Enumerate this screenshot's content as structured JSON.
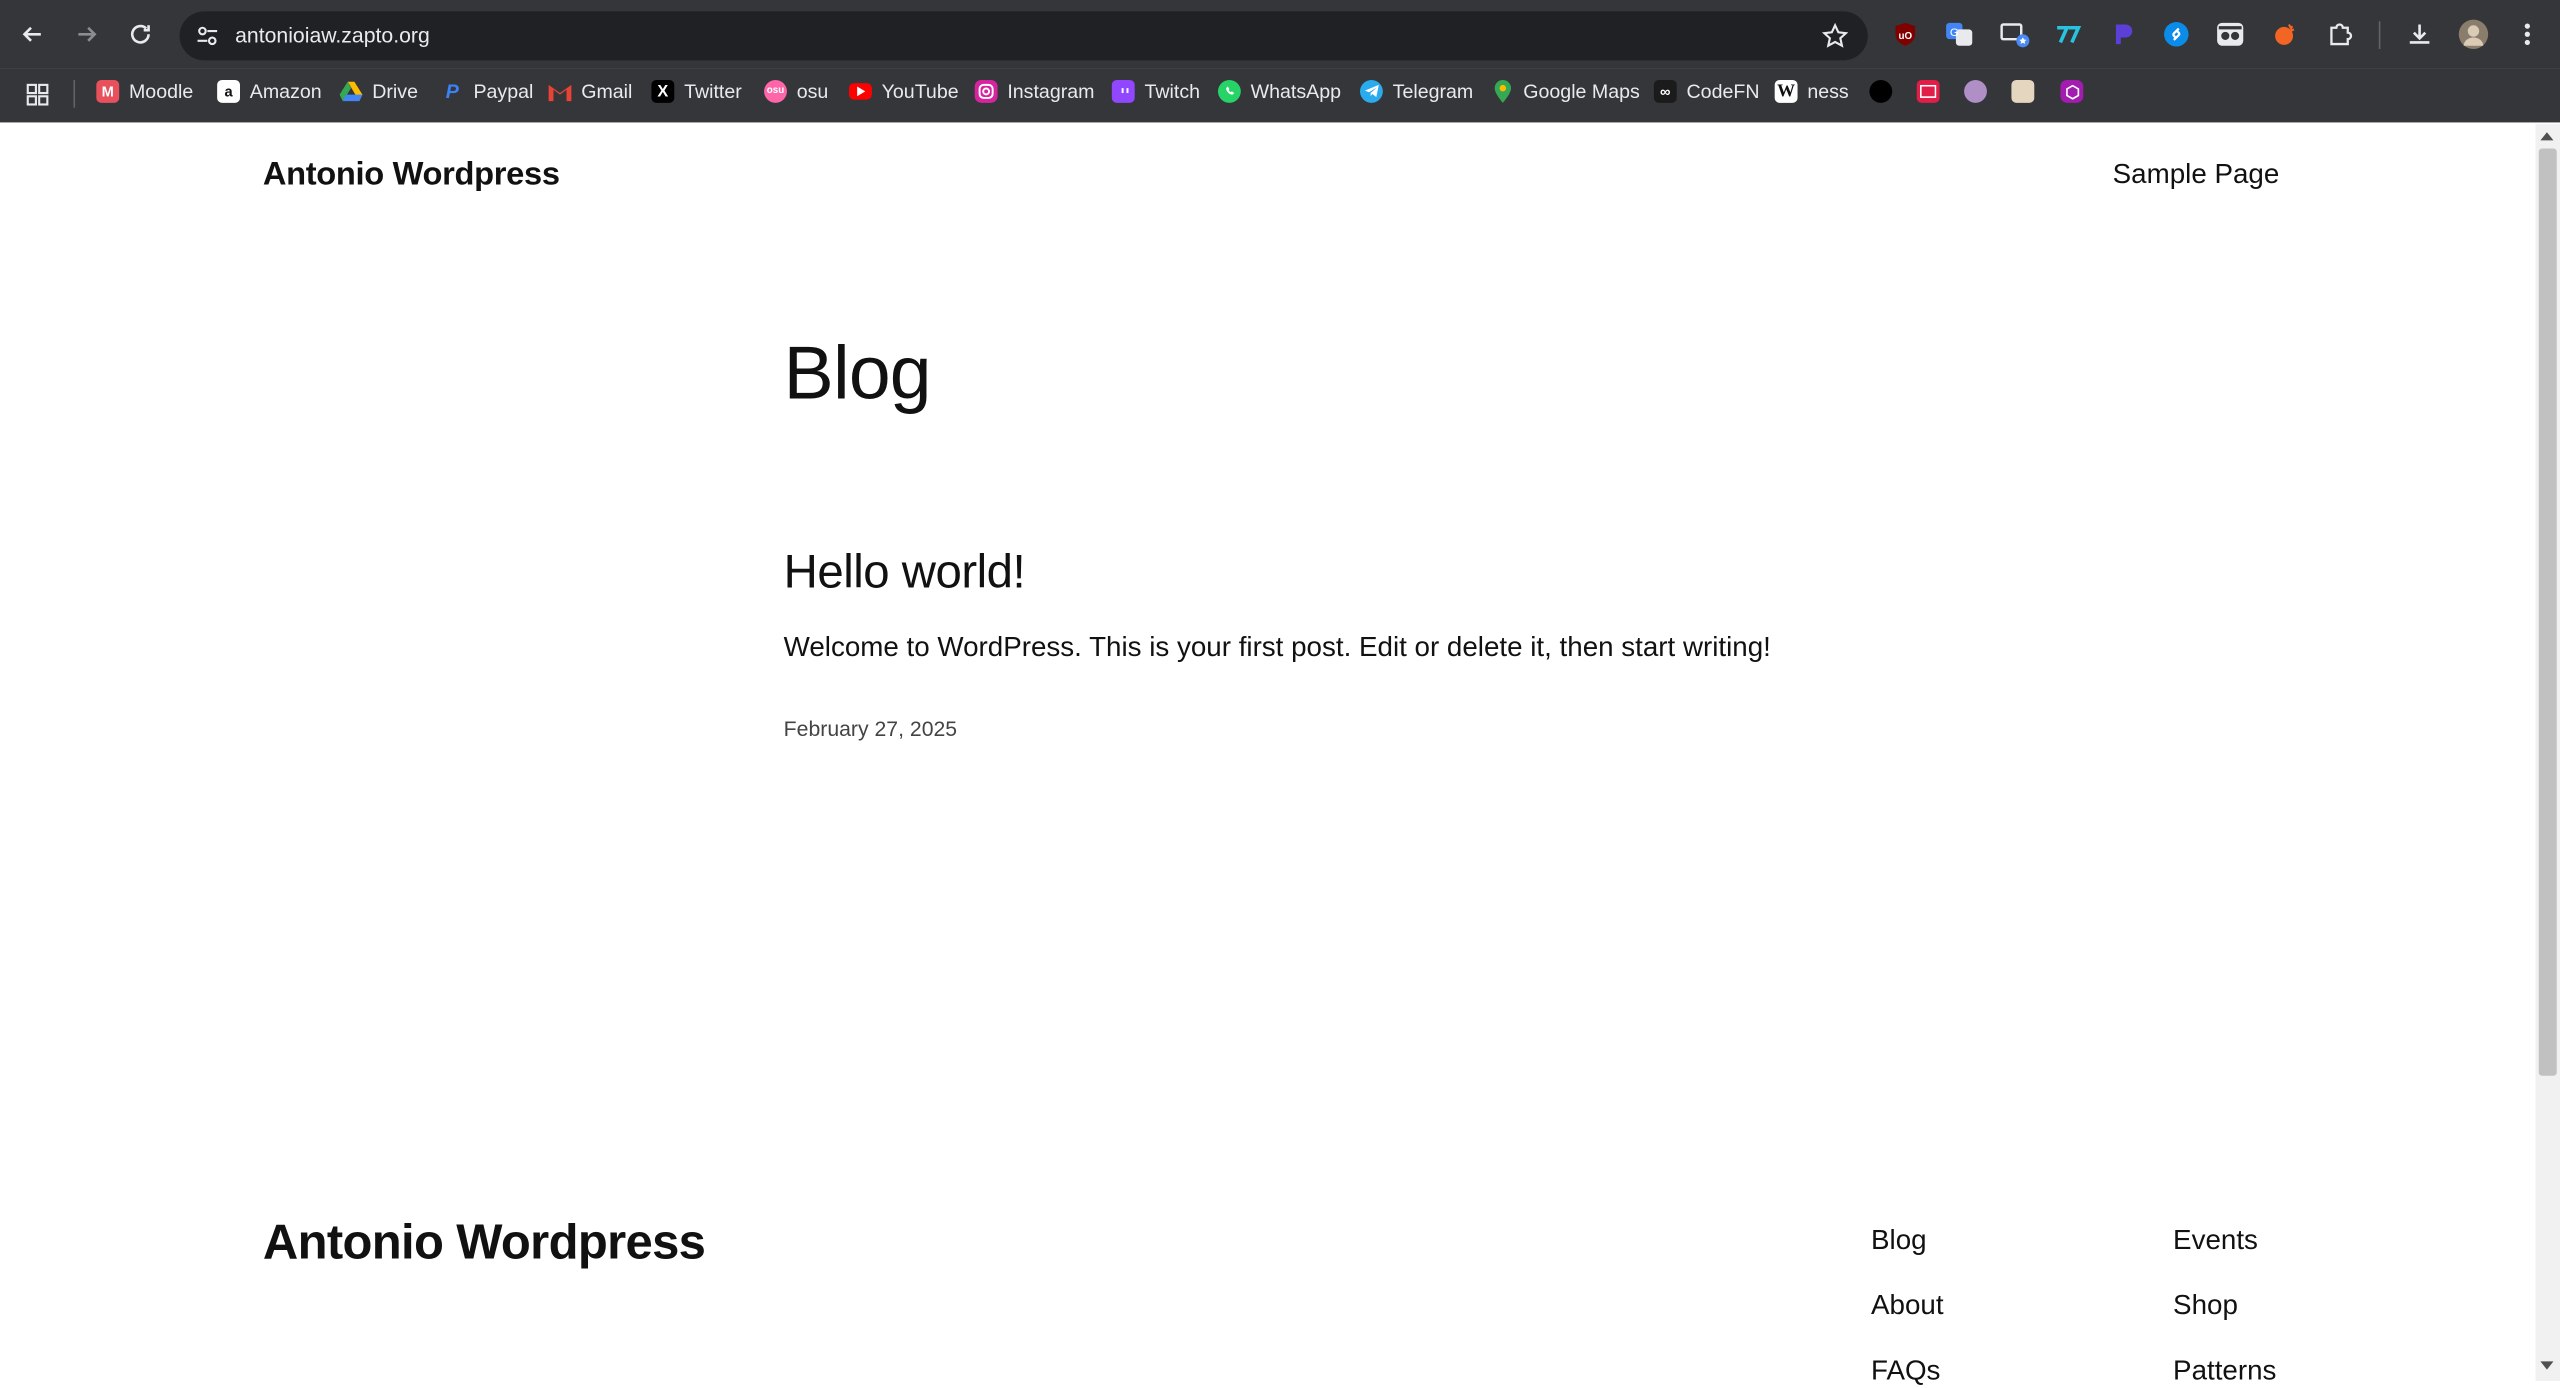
{
  "browser": {
    "url": "antonioiaw.zapto.org",
    "bookmarks": [
      {
        "label": "Moodle",
        "icon": "moodle-icon",
        "color": "#e8505b"
      },
      {
        "label": "Amazon",
        "icon": "amazon-icon",
        "color": "#ffffff"
      },
      {
        "label": "Drive",
        "icon": "google-drive-icon",
        "color": "#34a853"
      },
      {
        "label": "Paypal",
        "icon": "paypal-icon",
        "color": "#1e5bd6"
      },
      {
        "label": "Gmail",
        "icon": "gmail-icon",
        "color": "#ea4335"
      },
      {
        "label": "Twitter",
        "icon": "x-icon",
        "color": "#000000"
      },
      {
        "label": "osu",
        "icon": "osu-icon",
        "color": "#ff66aa"
      },
      {
        "label": "YouTube",
        "icon": "youtube-icon",
        "color": "#ff0000"
      },
      {
        "label": "Instagram",
        "icon": "instagram-icon",
        "color": "#d6249f"
      },
      {
        "label": "Twitch",
        "icon": "twitch-icon",
        "color": "#9146ff"
      },
      {
        "label": "WhatsApp",
        "icon": "whatsapp-icon",
        "color": "#25d366"
      },
      {
        "label": "Telegram",
        "icon": "telegram-icon",
        "color": "#2aabee"
      },
      {
        "label": "Google Maps",
        "icon": "google-maps-icon",
        "color": "#34a853"
      },
      {
        "label": "CodeFN",
        "icon": "codefn-icon",
        "color": "#1b1b1b"
      },
      {
        "label": "ness",
        "icon": "wikipedia-icon",
        "color": "#ffffff"
      }
    ]
  },
  "site": {
    "title": "Antonio Wordpress",
    "nav": {
      "sample_page": "Sample Page"
    }
  },
  "main": {
    "heading": "Blog",
    "post": {
      "title": "Hello world!",
      "excerpt": "Welcome to WordPress. This is your first post. Edit or delete it, then start writing!",
      "date": "February 27, 2025"
    }
  },
  "footer": {
    "title": "Antonio Wordpress",
    "col1": [
      "Blog",
      "About",
      "FAQs"
    ],
    "col2": [
      "Events",
      "Shop",
      "Patterns"
    ]
  }
}
